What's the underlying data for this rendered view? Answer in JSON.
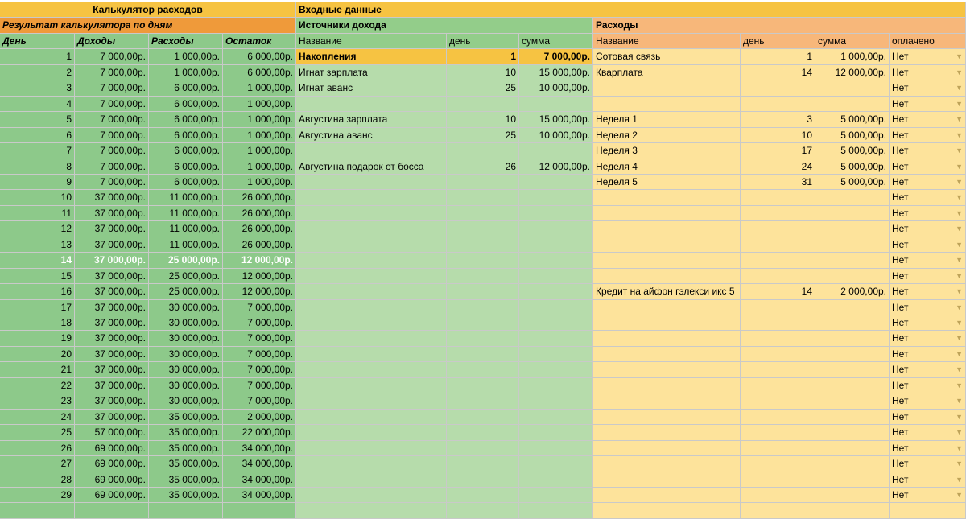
{
  "calc_title": "Калькулятор расходов",
  "input_title": "Входные данные",
  "result_title": "Результат калькулятора по дням",
  "income_title": "Источники дохода",
  "expense_title": "Расходы",
  "colors": {
    "green_dark": "#8dc98a",
    "green_light": "#b6dcab",
    "green_header": "#93cd8a",
    "orange_title": "#f6c342",
    "orange_result": "#ef9a3a",
    "expense_light": "#fde39b",
    "expense_header": "#f7b77a",
    "highlight_row": "#f6c342"
  },
  "result_headers": [
    "День",
    "Доходы",
    "Расходы",
    "Остаток"
  ],
  "result_rows": [
    [
      "1",
      "7 000,00р.",
      "1 000,00р.",
      "6 000,00р."
    ],
    [
      "2",
      "7 000,00р.",
      "1 000,00р.",
      "6 000,00р."
    ],
    [
      "3",
      "7 000,00р.",
      "6 000,00р.",
      "1 000,00р."
    ],
    [
      "4",
      "7 000,00р.",
      "6 000,00р.",
      "1 000,00р."
    ],
    [
      "5",
      "7 000,00р.",
      "6 000,00р.",
      "1 000,00р."
    ],
    [
      "6",
      "7 000,00р.",
      "6 000,00р.",
      "1 000,00р."
    ],
    [
      "7",
      "7 000,00р.",
      "6 000,00р.",
      "1 000,00р."
    ],
    [
      "8",
      "7 000,00р.",
      "6 000,00р.",
      "1 000,00р."
    ],
    [
      "9",
      "7 000,00р.",
      "6 000,00р.",
      "1 000,00р."
    ],
    [
      "10",
      "37 000,00р.",
      "11 000,00р.",
      "26 000,00р."
    ],
    [
      "11",
      "37 000,00р.",
      "11 000,00р.",
      "26 000,00р."
    ],
    [
      "12",
      "37 000,00р.",
      "11 000,00р.",
      "26 000,00р."
    ],
    [
      "13",
      "37 000,00р.",
      "11 000,00р.",
      "26 000,00р."
    ],
    [
      "14",
      "37 000,00р.",
      "25 000,00р.",
      "12 000,00р."
    ],
    [
      "15",
      "37 000,00р.",
      "25 000,00р.",
      "12 000,00р."
    ],
    [
      "16",
      "37 000,00р.",
      "25 000,00р.",
      "12 000,00р."
    ],
    [
      "17",
      "37 000,00р.",
      "30 000,00р.",
      "7 000,00р."
    ],
    [
      "18",
      "37 000,00р.",
      "30 000,00р.",
      "7 000,00р."
    ],
    [
      "19",
      "37 000,00р.",
      "30 000,00р.",
      "7 000,00р."
    ],
    [
      "20",
      "37 000,00р.",
      "30 000,00р.",
      "7 000,00р."
    ],
    [
      "21",
      "37 000,00р.",
      "30 000,00р.",
      "7 000,00р."
    ],
    [
      "22",
      "37 000,00р.",
      "30 000,00р.",
      "7 000,00р."
    ],
    [
      "23",
      "37 000,00р.",
      "30 000,00р.",
      "7 000,00р."
    ],
    [
      "24",
      "37 000,00р.",
      "35 000,00р.",
      "2 000,00р."
    ],
    [
      "25",
      "57 000,00р.",
      "35 000,00р.",
      "22 000,00р."
    ],
    [
      "26",
      "69 000,00р.",
      "35 000,00р.",
      "34 000,00р."
    ],
    [
      "27",
      "69 000,00р.",
      "35 000,00р.",
      "34 000,00р."
    ],
    [
      "28",
      "69 000,00р.",
      "35 000,00р.",
      "34 000,00р."
    ],
    [
      "29",
      "69 000,00р.",
      "35 000,00р.",
      "34 000,00р."
    ]
  ],
  "income_headers": [
    "Название",
    "день",
    "сумма"
  ],
  "income_rows": [
    [
      "Накопления",
      "1",
      "7 000,00р."
    ],
    [
      "Игнат зарплата",
      "10",
      "15 000,00р."
    ],
    [
      "Игнат аванс",
      "25",
      "10 000,00р."
    ],
    [
      "",
      "",
      ""
    ],
    [
      "Августина зарплата",
      "10",
      "15 000,00р."
    ],
    [
      "Августина аванс",
      "25",
      "10 000,00р."
    ],
    [
      "",
      "",
      ""
    ],
    [
      "Августина подарок от босса",
      "26",
      "12 000,00р."
    ]
  ],
  "expense_headers": [
    "Название",
    "день",
    "сумма",
    "оплачено"
  ],
  "expense_rows": [
    [
      "Сотовая связь",
      "1",
      "1 000,00р."
    ],
    [
      "Кварплата",
      "14",
      "12 000,00р."
    ],
    [
      "",
      "",
      ""
    ],
    [
      "",
      "",
      ""
    ],
    [
      "Неделя 1",
      "3",
      "5 000,00р."
    ],
    [
      "Неделя 2",
      "10",
      "5 000,00р."
    ],
    [
      "Неделя 3",
      "17",
      "5 000,00р."
    ],
    [
      "Неделя 4",
      "24",
      "5 000,00р."
    ],
    [
      "Неделя 5",
      "31",
      "5 000,00р."
    ],
    [
      "",
      "",
      ""
    ],
    [
      "",
      "",
      ""
    ],
    [
      "",
      "",
      ""
    ],
    [
      "",
      "",
      ""
    ],
    [
      "",
      "",
      ""
    ],
    [
      "",
      "",
      ""
    ],
    [
      "Кредит на айфон гэлекси икс 5",
      "14",
      "2 000,00р."
    ]
  ],
  "paid_value": "Нет"
}
